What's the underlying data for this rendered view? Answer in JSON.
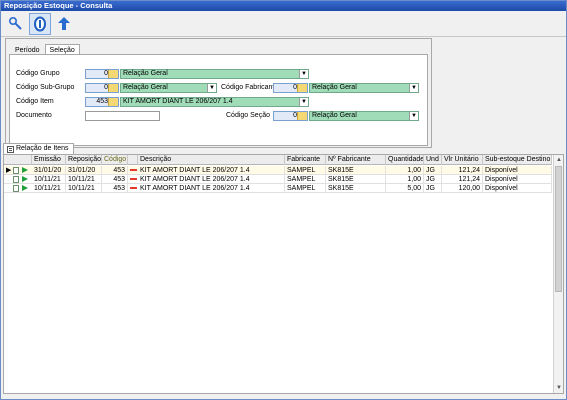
{
  "window": {
    "title": "Reposição Estoque - Consulta"
  },
  "toolbar": {
    "buttons": [
      {
        "icon": "wrench-icon"
      },
      {
        "icon": "info-icon"
      },
      {
        "icon": "back-arrow-icon"
      }
    ]
  },
  "filters": {
    "tabs": [
      {
        "label": "Período"
      },
      {
        "label": "Seleção"
      }
    ],
    "selected_tab": "Seleção",
    "codigo_grupo": {
      "label": "Código Grupo",
      "value": "0",
      "desc": "Relação Geral"
    },
    "codigo_subgrupo": {
      "label": "Código Sub-Grupo",
      "value": "0",
      "desc": "Relação Geral"
    },
    "codigo_fabricante": {
      "label": "Código Fabricante",
      "value": "0",
      "desc": "Relação Geral"
    },
    "codigo_item": {
      "label": "Código Item",
      "value": "453",
      "desc": "KIT AMORT DIANT LE 206/207 1.4"
    },
    "documento": {
      "label": "Documento",
      "value": ""
    },
    "codigo_secao": {
      "label": "Código Seção",
      "value": "0",
      "desc": "Relação Geral"
    }
  },
  "grid": {
    "tab_label": "Relação de Itens",
    "columns": [
      "Emissão",
      "Reposição",
      "Código",
      "Descrição",
      "Fabricante",
      "Nº Fabricante",
      "Quantidade",
      "Und",
      "Vlr Unitário",
      "Sub-estoque Destino"
    ],
    "rows": [
      {
        "emissao": "31/01/20",
        "reposicao": "31/01/20",
        "codigo": "453",
        "descricao": "KIT AMORT DIANT LE 206/207 1.4",
        "fabricante": "SAMPEL",
        "nfab": "SK815E",
        "qtd": "1,00",
        "und": "JG",
        "vlr": "121,24",
        "sub": "Disponível"
      },
      {
        "emissao": "10/11/21",
        "reposicao": "10/11/21",
        "codigo": "453",
        "descricao": "KIT AMORT DIANT LE 206/207 1.4",
        "fabricante": "SAMPEL",
        "nfab": "SK815E",
        "qtd": "1,00",
        "und": "JG",
        "vlr": "121,24",
        "sub": "Disponível"
      },
      {
        "emissao": "10/11/21",
        "reposicao": "10/11/21",
        "codigo": "453",
        "descricao": "KIT AMORT DIANT LE 206/207 1.4",
        "fabricante": "SAMPEL",
        "nfab": "SK815E",
        "qtd": "5,00",
        "und": "JG",
        "vlr": "120,00",
        "sub": "Disponível"
      }
    ]
  },
  "colors": {
    "title": "#1c4aa8",
    "combo": "#9fdcb7",
    "numbox": "#e2eaf7"
  }
}
